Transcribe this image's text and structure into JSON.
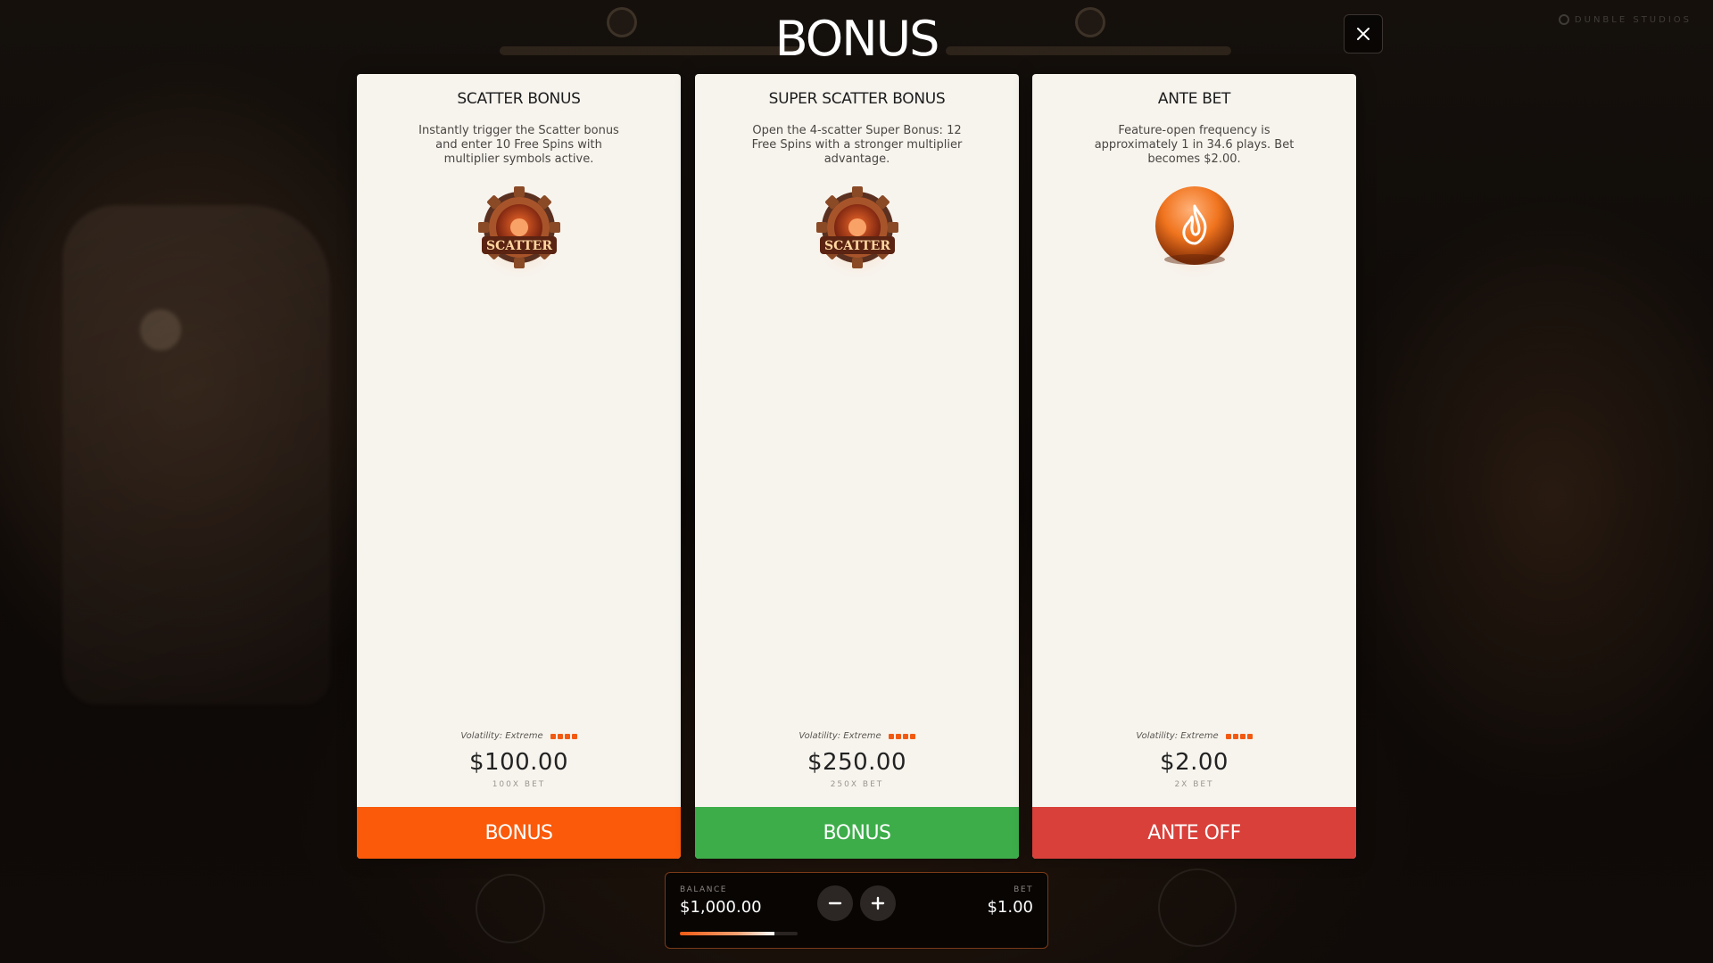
{
  "header": {
    "title": "BONUS",
    "close_icon": "close-icon"
  },
  "brand": {
    "text": "DUNBLE STUDIOS"
  },
  "cards": [
    {
      "title": "SCATTER BONUS",
      "description": "Instantly trigger the Scatter bonus and enter 10 Free Spins with multiplier symbols active.",
      "icon": "scatter-gear-icon",
      "icon_text": "SCATTER",
      "volatility": "Volatility: Extreme",
      "volatility_level": 4,
      "price": "$100.00",
      "multiplier": "100X BET",
      "button_label": "BONUS",
      "button_color": "#fa5a0a"
    },
    {
      "title": "SUPER SCATTER BONUS",
      "description": "Open the 4-scatter Super Bonus: 12 Free Spins with a stronger multiplier advantage.",
      "icon": "scatter-gear-icon",
      "icon_text": "SCATTER",
      "volatility": "Volatility: Extreme",
      "volatility_level": 4,
      "price": "$250.00",
      "multiplier": "250X BET",
      "button_label": "BONUS",
      "button_color": "#3dad4a"
    },
    {
      "title": "ANTE BET",
      "description": "Feature-open frequency is approximately 1 in 34.6 plays. Bet becomes $2.00.",
      "icon": "flame-icon",
      "volatility": "Volatility: Extreme",
      "volatility_level": 4,
      "price": "$2.00",
      "multiplier": "2X BET",
      "button_label": "ANTE OFF",
      "button_color": "#d9403a"
    }
  ],
  "bottom_bar": {
    "balance_label": "BALANCE",
    "balance_value": "$1,000.00",
    "bet_label": "BET",
    "bet_value": "$1.00",
    "decrease_icon": "minus-icon",
    "increase_icon": "plus-icon",
    "bet_progress": 0.8
  },
  "colors": {
    "accent": "#f25a12",
    "card_bg": "#f7f4ee"
  }
}
